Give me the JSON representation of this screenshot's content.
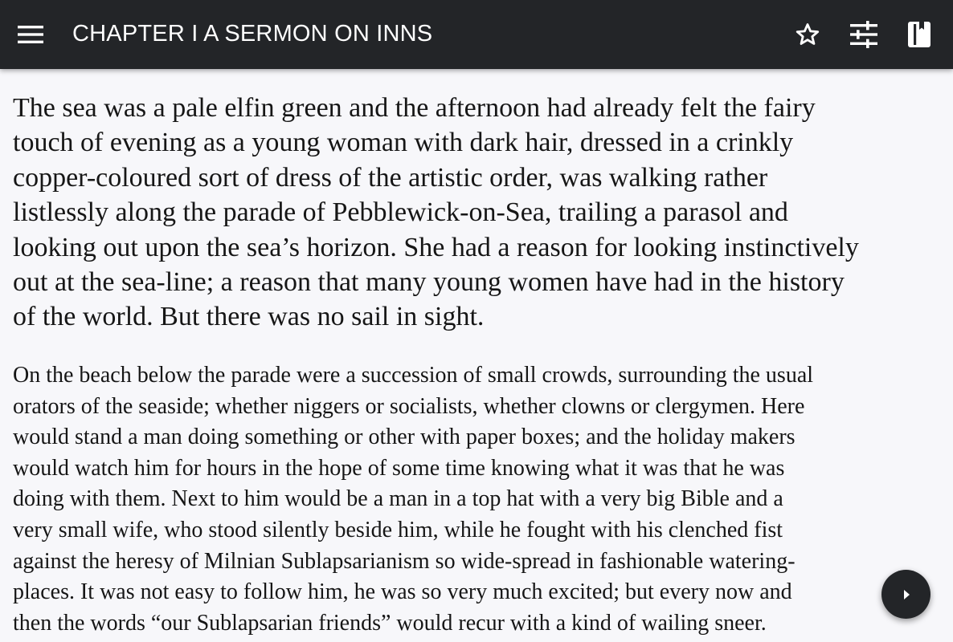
{
  "app_bar": {
    "title": "CHAPTER I A SERMON ON INNS",
    "icons": {
      "menu": "menu-icon",
      "bookmark": "star-icon",
      "settings": "tune-icon",
      "toc": "book-icon"
    },
    "background": "#232528",
    "foreground": "#ffffff"
  },
  "content": {
    "paragraphs": [
      {
        "lines": [
          "The sea was a pale elfin green and the afternoon had already felt the fairy",
          "touch of evening as a young woman with dark hair, dressed in a crinkly",
          "copper-coloured sort of dress of the artistic order, was walking rather",
          "listlessly along the parade of Pebblewick-on-Sea, trailing a parasol and",
          "looking out upon the sea’s horizon. She had a reason for looking instinctively",
          "out at the sea-line; a reason that many young women have had in the history",
          "of the world. But there was no sail in sight."
        ]
      },
      {
        "lines": [
          "On the beach below the parade were a succession of small crowds, surrounding the usual",
          "orators of the seaside; whether niggers or socialists, whether clowns or clergymen. Here",
          "would stand a man doing something or other with paper boxes; and the holiday makers",
          "would watch him for hours in the hope of some time knowing what it was that he was",
          "doing with them. Next to him would be a man in a top hat with a very big Bible and a",
          "very small wife, who stood silently beside him, while he fought with his clenched fist",
          "against the heresy of Milnian Sublapsarianism so wide-spread in fashionable watering-",
          "places. It was not easy to follow him, he was so very much excited; but every now and",
          "then the words “our Sublapsarian friends” would recur with a kind of wailing sneer."
        ]
      }
    ],
    "text_color": "#161616",
    "background": "#f7f7fa"
  },
  "fab": {
    "icon": "play-arrow-icon",
    "background": "#232528"
  }
}
